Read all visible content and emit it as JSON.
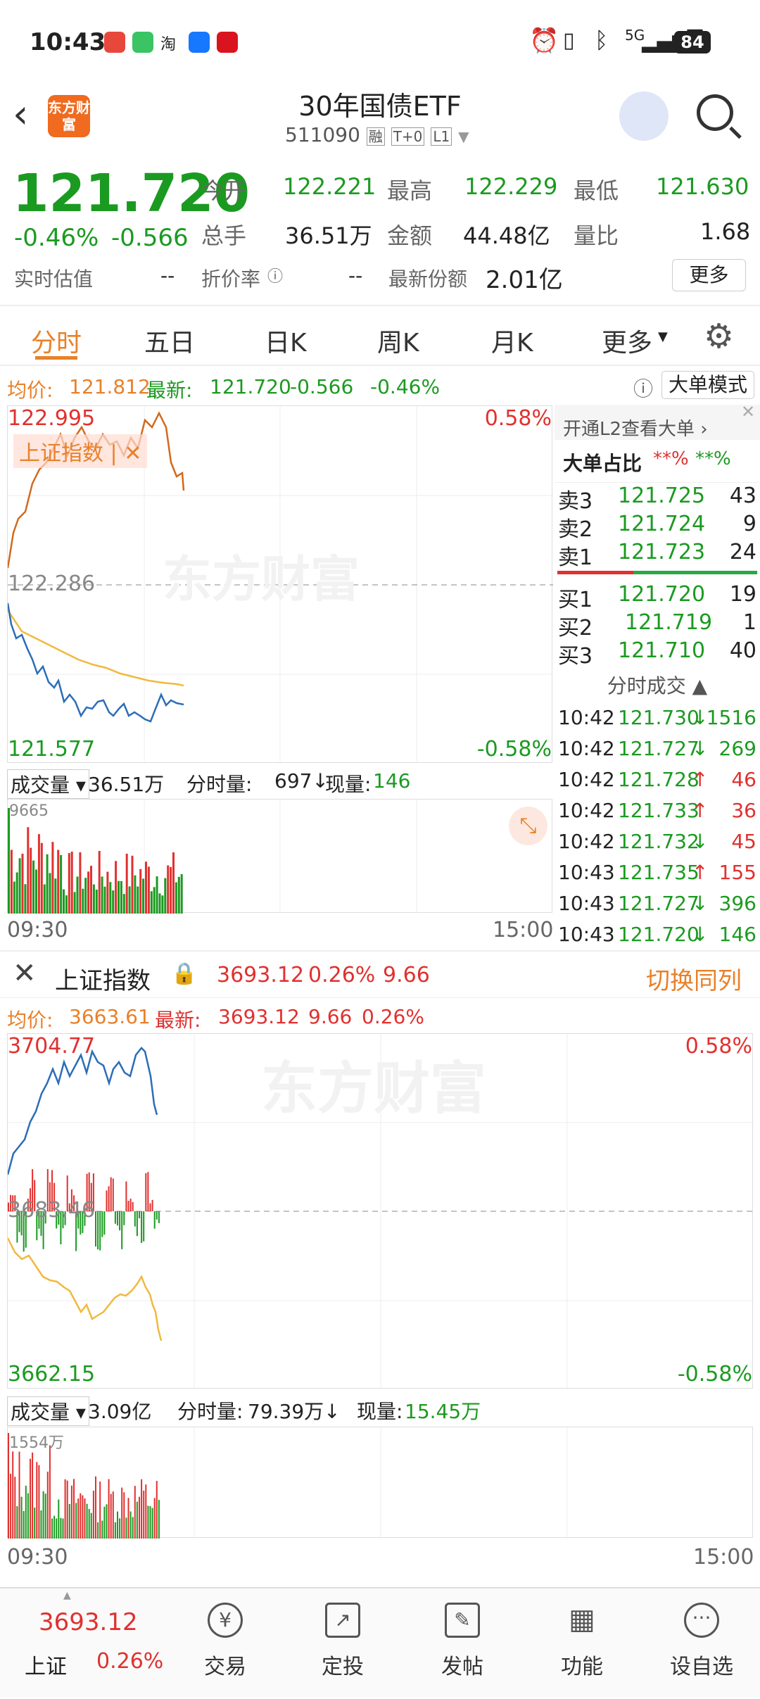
{
  "status": {
    "time": "10:43",
    "battery": "84",
    "network": "5G"
  },
  "header": {
    "title": "30年国债ETF",
    "code": "511090",
    "tags": [
      "融",
      "T+0",
      "L1"
    ],
    "logo": "东方财富"
  },
  "quote": {
    "price": "121.720",
    "chg_pct": "-0.46%",
    "chg": "-0.566",
    "open_label": "今开",
    "open": "122.221",
    "high_label": "最高",
    "high": "122.229",
    "low_label": "最低",
    "low": "121.630",
    "vol_label": "总手",
    "vol": "36.51万",
    "amt_label": "金额",
    "amt": "44.48亿",
    "ratio_label": "量比",
    "ratio": "1.68",
    "est_label": "实时估值",
    "est": "--",
    "disc_label": "折价率",
    "disc": "--",
    "share_label": "最新份额",
    "share": "2.01亿",
    "more": "更多"
  },
  "tabs": [
    "分时",
    "五日",
    "日K",
    "周K",
    "月K",
    "更多"
  ],
  "linebar": {
    "avg_label": "均价:",
    "avg": "121.812",
    "last_label": "最新:",
    "last": "121.720",
    "chg": "-0.566",
    "pct": "-0.46%",
    "big_mode": "大单模式"
  },
  "chart1": {
    "top": "122.995",
    "mid": "122.286",
    "bot": "121.577",
    "top_pct": "0.58%",
    "bot_pct": "-0.58%",
    "overlay": "上证指数",
    "watermark": "东方财富",
    "vol_label": "成交量",
    "vol_total": "36.51万",
    "fen_label": "分时量:",
    "fen": "697",
    "now_label": "现量:",
    "now": "146",
    "vol_max": "9665",
    "t_start": "09:30",
    "t_end": "15:00"
  },
  "l2": {
    "promo": "开通L2查看大单",
    "big_label": "大单占比",
    "big_sell": "**%",
    "big_buy": "**%",
    "asks": [
      {
        "l": "卖3",
        "p": "121.725",
        "v": "43"
      },
      {
        "l": "卖2",
        "p": "121.724",
        "v": "9"
      },
      {
        "l": "卖1",
        "p": "121.723",
        "v": "24"
      }
    ],
    "bids": [
      {
        "l": "买1",
        "p": "121.720",
        "v": "19"
      },
      {
        "l": "买2",
        "p": "121.719",
        "v": "1"
      },
      {
        "l": "买3",
        "p": "121.710",
        "v": "40"
      }
    ],
    "trades_label": "分时成交",
    "trades": [
      {
        "t": "10:42",
        "p": "121.730",
        "d": "↓",
        "v": "1516",
        "c": "green"
      },
      {
        "t": "10:42",
        "p": "121.727",
        "d": "↓",
        "v": "269",
        "c": "green"
      },
      {
        "t": "10:42",
        "p": "121.728",
        "d": "↑",
        "v": "46",
        "c": "red"
      },
      {
        "t": "10:42",
        "p": "121.733",
        "d": "↑",
        "v": "36",
        "c": "red"
      },
      {
        "t": "10:42",
        "p": "121.732",
        "d": "↓",
        "v": "45",
        "c": "green"
      },
      {
        "t": "10:43",
        "p": "121.735",
        "d": "↑",
        "v": "155",
        "c": "red"
      },
      {
        "t": "10:43",
        "p": "121.727",
        "d": "↓",
        "v": "396",
        "c": "green"
      },
      {
        "t": "10:43",
        "p": "121.720",
        "d": "↓",
        "v": "146",
        "c": "green"
      }
    ]
  },
  "sec2": {
    "name": "上证指数",
    "price": "3693.12",
    "pct": "0.26%",
    "chg": "9.66",
    "switch": "切换同列",
    "avg_label": "均价:",
    "avg": "3663.61",
    "last_label": "最新:",
    "last": "3693.12",
    "chg2": "9.66",
    "pct2": "0.26%",
    "top": "3704.77",
    "mid": "3683.46",
    "bot": "3662.15",
    "top_pct": "0.58%",
    "bot_pct": "-0.58%",
    "watermark": "东方财富",
    "vol_label": "成交量",
    "vol_total": "3.09亿",
    "fen_label": "分时量:",
    "fen": "79.39万",
    "now_label": "现量:",
    "now": "15.45万",
    "vol_max": "1554万",
    "t_start": "09:30",
    "t_end": "15:00"
  },
  "nav": {
    "index_price": "3693.12",
    "index_name": "上证",
    "index_pct": "0.26%",
    "items": [
      "交易",
      "定投",
      "发帖",
      "功能",
      "设自选"
    ]
  }
}
